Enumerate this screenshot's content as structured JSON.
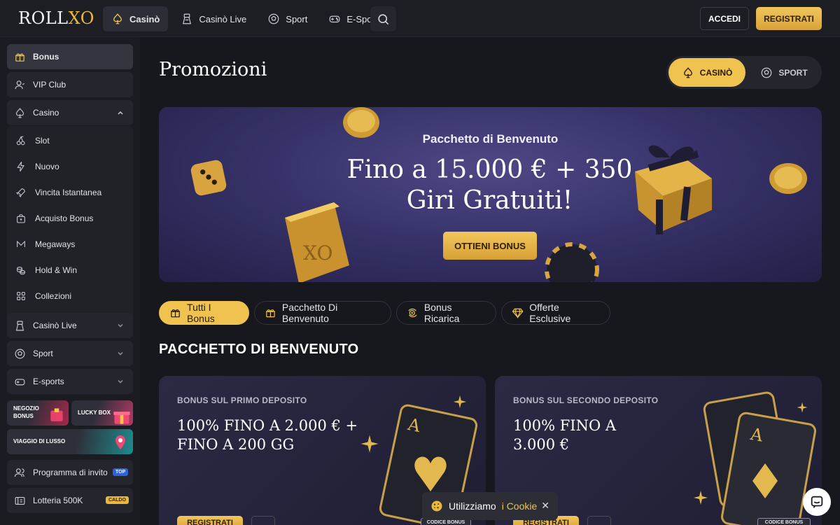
{
  "header": {
    "logo_text": "ROLL",
    "logo_accent": "XO",
    "nav": [
      {
        "label": "Casinò",
        "icon": "spade-icon",
        "active": true
      },
      {
        "label": "Casinò Live",
        "icon": "dealer-icon"
      },
      {
        "label": "Sport",
        "icon": "soccer-ball-icon"
      },
      {
        "label": "E-Sports",
        "icon": "gamepad-icon"
      }
    ],
    "login": "ACCEDI",
    "register": "REGISTRATI"
  },
  "sidebar": {
    "bonus": "Bonus",
    "vip": "VIP Club",
    "casino": "Casino",
    "casino_sub": [
      "Slot",
      "Nuovo",
      "Vincita Istantanea",
      "Acquisto Bonus",
      "Megaways",
      "Hold & Win",
      "Collezioni"
    ],
    "live": "Casinò Live",
    "sport": "Sport",
    "esports": "E-sports",
    "shop_line1": "NEGOZIO",
    "shop_line2": "BONUS",
    "lucky": "LUCKY BOX",
    "travel": "VIAGGIO DI LUSSO",
    "invite": "Programma di invito",
    "invite_tag": "TOP",
    "lottery": "Lotteria 500K",
    "lottery_tag": "CALDO"
  },
  "main": {
    "title": "Promozioni",
    "toggle": {
      "casino": "CASINÒ",
      "sport": "SPORT"
    },
    "hero": {
      "kicker": "Pacchetto di Benvenuto",
      "title": "Fino a 15.000 € + 350 Giri Gratuiti!",
      "button": "OTTIENI BONUS"
    },
    "filters": [
      "Tutti I Bonus",
      "Pacchetto Di Benvenuto",
      "Bonus Ricarica",
      "Offerte Esclusive"
    ],
    "section_title": "PACCHETTO DI BENVENUTO",
    "cards": [
      {
        "kicker": "BONUS SUL PRIMO DEPOSITO",
        "title": "100% FINO A 2.000 € + FINO A 200 GG",
        "button": "REGISTRATI",
        "code": "CODICE BONUS"
      },
      {
        "kicker": "BONUS SUL SECONDO DEPOSITO",
        "title": "100% FINO A 3.000 €",
        "button": "REGISTRATI",
        "code": "CODICE BONUS"
      }
    ]
  },
  "cookie": {
    "text": "Utilizziamo",
    "link": "i Cookie",
    "close": "✕"
  },
  "colors": {
    "accent": "#f0c24f",
    "bg": "#17181d",
    "hero": "#37336a"
  }
}
